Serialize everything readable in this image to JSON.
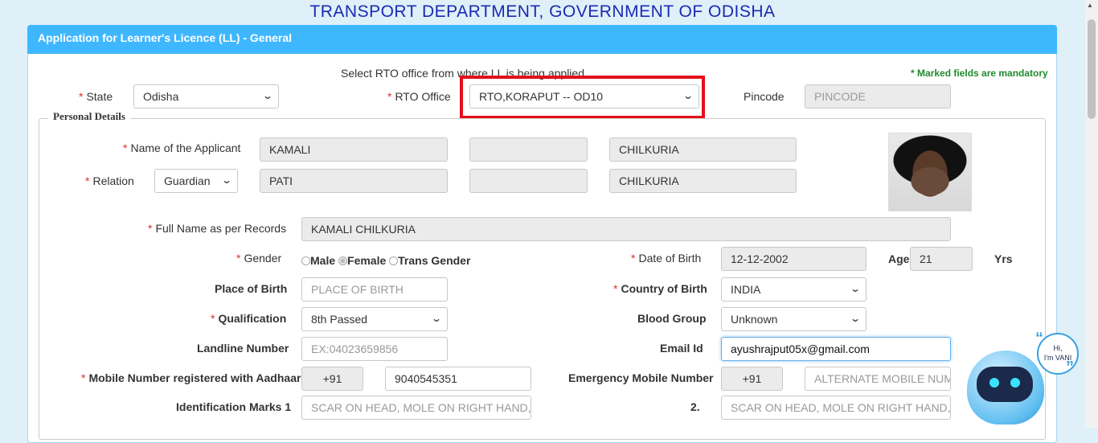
{
  "header": {
    "title": "TRANSPORT DEPARTMENT, GOVERNMENT OF ODISHA"
  },
  "panel": {
    "title": "Application for Learner's Licence (LL) - General"
  },
  "rto_section": {
    "instruction": "Select RTO office from where LL is being applied",
    "mandatory_note": "* Marked fields are mandatory",
    "state_label": "State",
    "state_value": "Odisha",
    "rto_label": "RTO Office",
    "rto_value": "RTO,KORAPUT -- OD10",
    "pincode_label": "Pincode",
    "pincode_placeholder": "PINCODE"
  },
  "personal": {
    "legend": "Personal Details",
    "name_label": "Name of the Applicant",
    "first_name": "KAMALI",
    "middle_name": "",
    "last_name": "CHILKURIA",
    "relation_label": "Relation",
    "relation_value": "Guardian",
    "relation_first": "PATI",
    "relation_middle": "",
    "relation_last": "CHILKURIA",
    "fullname_label": "Full Name as per Records",
    "fullname_value": "KAMALI CHILKURIA",
    "gender_label": "Gender",
    "gender_options": [
      "Male",
      "Female",
      "Trans Gender"
    ],
    "gender_selected": "Female",
    "dob_label": "Date of Birth",
    "dob_value": "12-12-2002",
    "age_label": "Age",
    "age_value": "21",
    "age_unit": "Yrs",
    "pob_label": "Place of Birth",
    "pob_placeholder": "PLACE OF BIRTH",
    "cob_label": "Country of Birth",
    "cob_value": "INDIA",
    "qual_label": "Qualification",
    "qual_value": "8th Passed",
    "blood_label": "Blood Group",
    "blood_value": "Unknown",
    "landline_label": "Landline Number",
    "landline_placeholder": "EX:04023659856",
    "email_label": "Email Id",
    "email_value": "ayushrajput05x@gmail.com",
    "mobile_label": "Mobile Number registered with Aadhaar",
    "mobile_code": "+91",
    "mobile_value": "9040545351",
    "emergency_label": "Emergency Mobile Number",
    "emergency_code": "+91",
    "emergency_placeholder": "ALTERNATE MOBILE NUMI",
    "id_marks1_label": "Identification Marks 1",
    "id_marks1_placeholder": "SCAR ON HEAD, MOLE ON RIGHT HAND, ET",
    "id_marks2_label": "2.",
    "id_marks2_placeholder": "SCAR ON HEAD, MOLE ON RIGHT HAND, ET"
  },
  "chatbot": {
    "line1": "Hi,",
    "line2": "I'm VANI"
  },
  "icons": {
    "dropdown": "chevron-down-icon",
    "required": "*"
  },
  "colors": {
    "header_bar": "#3fb7ff",
    "title": "#1a2ab5",
    "highlight": "#e3101b",
    "mandatory": "#1f8b2c"
  }
}
